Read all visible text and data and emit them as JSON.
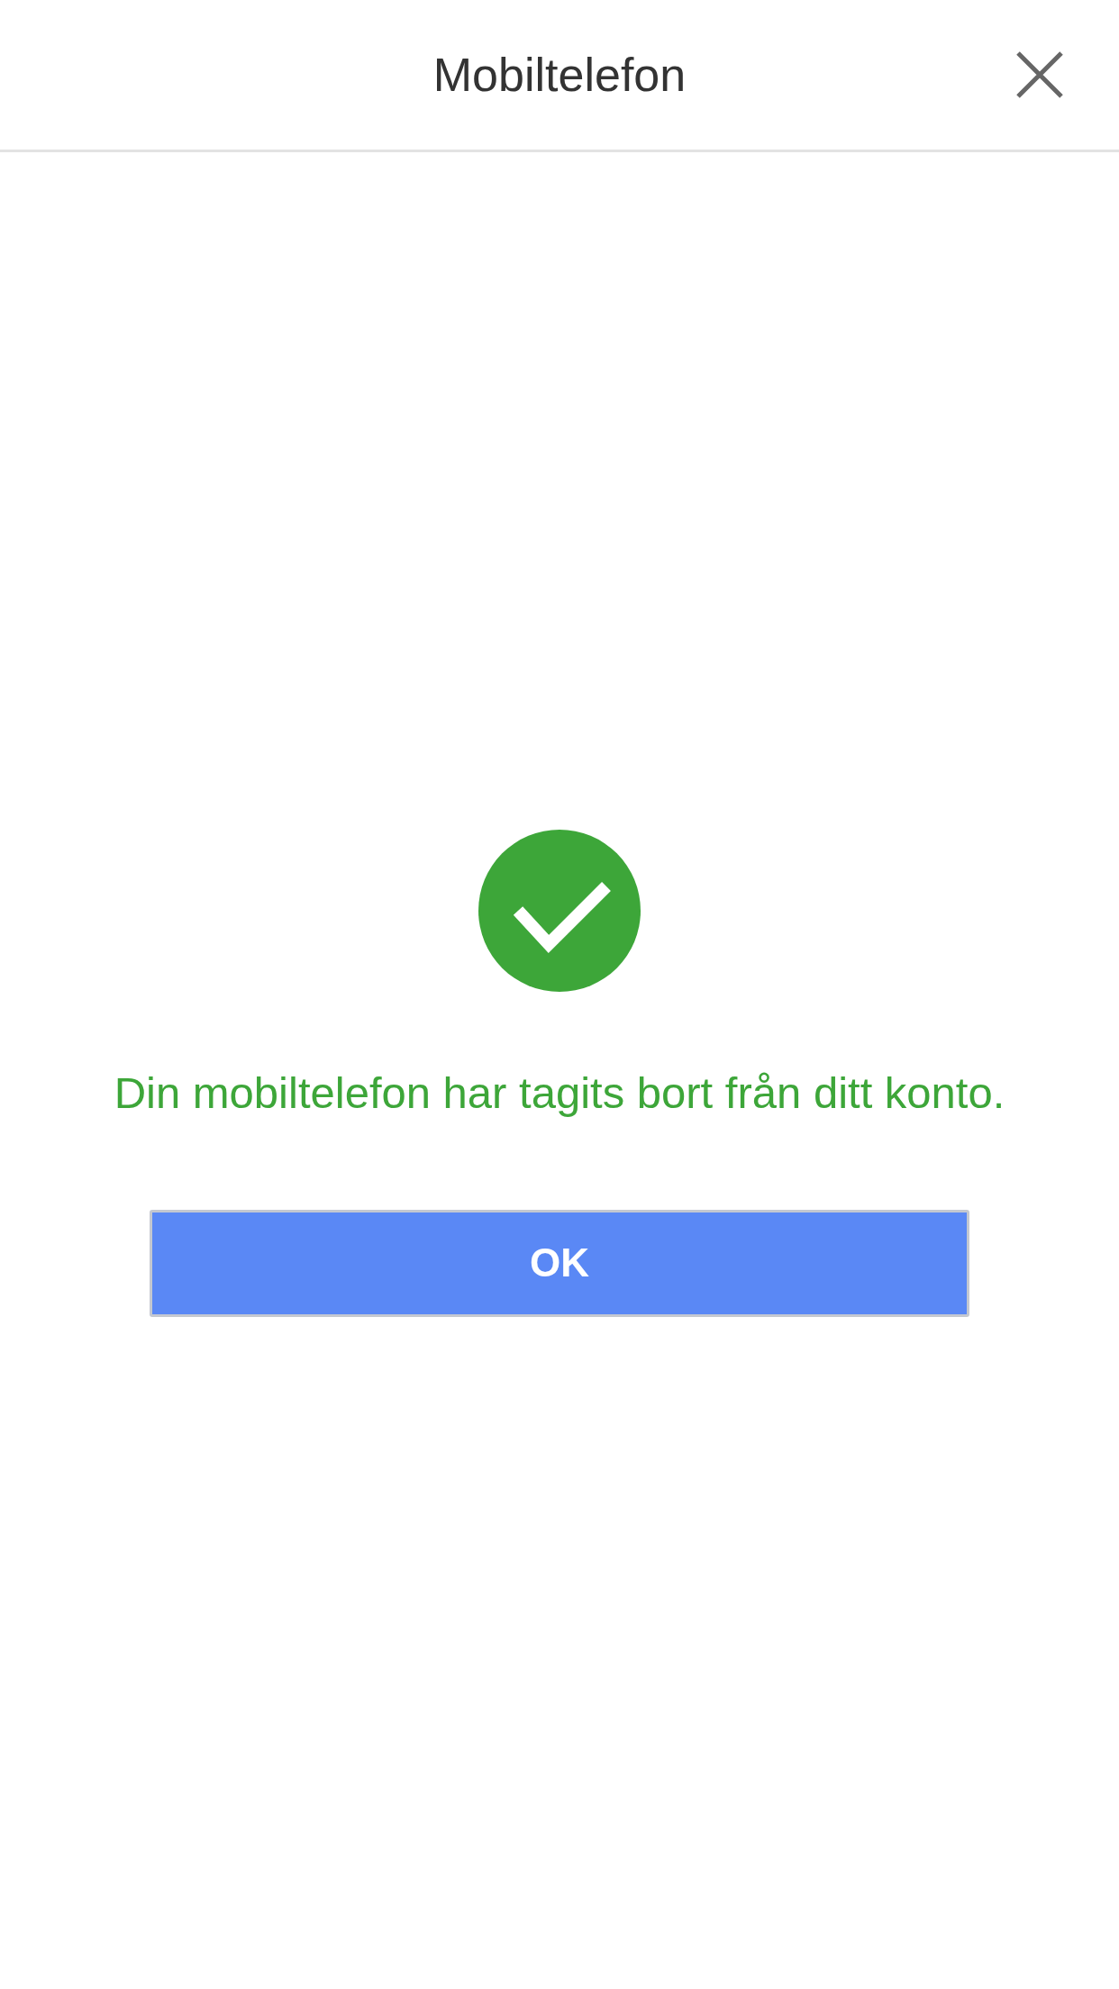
{
  "header": {
    "title": "Mobiltelefon"
  },
  "result": {
    "success": true,
    "message": "Din mobiltelefon har tagits bort från ditt konto."
  },
  "buttons": [
    {
      "label": "OK"
    }
  ]
}
